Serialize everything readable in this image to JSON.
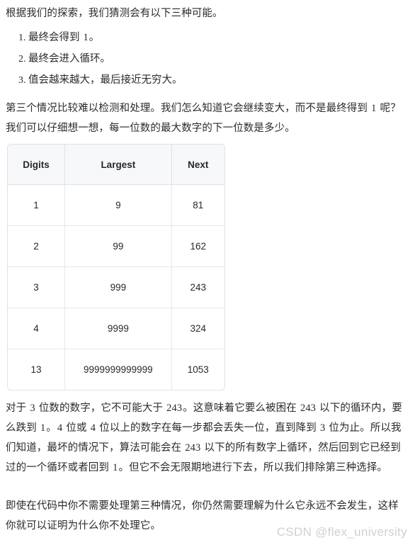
{
  "article": {
    "intro_paragraph": "根据我们的探索，我们猜测会有以下三种可能。",
    "possibilities": [
      {
        "prefix": "最终会得到 ",
        "number": "1",
        "suffix": "。"
      },
      {
        "prefix": "最终会进入循环。",
        "number": "",
        "suffix": ""
      },
      {
        "prefix": "值会越来越大，最后接近无穷大。",
        "number": "",
        "suffix": ""
      }
    ],
    "second_paragraph": {
      "part1": "第三个情况比较难以检测和处理。我们怎么知道它会继续变大，而不是最终得到 ",
      "num1": "1",
      "part2": " 呢？我们可以仔细想一想，每一位数的最大数字的下一位数是多少。"
    },
    "after_table_paragraph": {
      "s1": "对于 ",
      "n1": "3",
      "s2": " 位数的数字，它不可能大于 ",
      "n2": "243",
      "s3": "。这意味着它要么被困在 ",
      "n3": "243",
      "s4": " 以下的循环内，要么跌到 ",
      "n4": "1",
      "s5": "。",
      "n5": "4",
      "s6": " 位或 ",
      "n6": "4",
      "s7": " 位以上的数字在每一步都会丢失一位，直到降到 ",
      "n7": "3",
      "s8": " 位为止。所以我们知道，最坏的情况下，算法可能会在 ",
      "n8": "243",
      "s9": " 以下的所有数字上循环，然后回到它已经到过的一个循环或者回到 ",
      "n9": "1",
      "s10": "。但它不会无限期地进行下去，所以我们排除第三种选择。"
    },
    "final_paragraph": "即使在代码中你不需要处理第三种情况，你仍然需要理解为什么它永远不会发生，这样你就可以证明为什么你不处理它。"
  },
  "table": {
    "headers": [
      "Digits",
      "Largest",
      "Next"
    ],
    "rows": [
      {
        "digits": "1",
        "largest": "9",
        "next": "81"
      },
      {
        "digits": "2",
        "largest": "99",
        "next": "162"
      },
      {
        "digits": "3",
        "largest": "999",
        "next": "243"
      },
      {
        "digits": "4",
        "largest": "9999",
        "next": "324"
      },
      {
        "digits": "13",
        "largest": "9999999999999",
        "next": "1053"
      }
    ]
  },
  "watermark": "CSDN @flex_university",
  "colors": {
    "text": "#2b2b2b",
    "table_header_bg": "#f6f8fa",
    "table_border": "#dfe2e5",
    "watermark": "#d0d0d0"
  }
}
